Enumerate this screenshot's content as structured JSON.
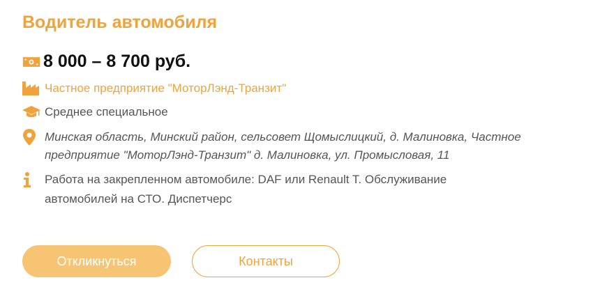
{
  "vacancy": {
    "title": "Водитель автомобиля",
    "salary": "8 000 – 8 700 руб.",
    "company": "Частное предприятие \"МоторЛэнд-Транзит\"",
    "education": "Среднее специальное",
    "address_line1": "Минская область, Минский район, сельсовет Щомыслицкий, д. Малиновка, Частное",
    "address_line2": "предприятие \"МоторЛэнд-Транзит\" д. Малиновка, ул. Промысловая, 11",
    "description_line1": "Работа на закрепленном автомобиле: DAF или Renault T. Обслуживание",
    "description_line2": "автомобилей на СТО. Диспетчерс"
  },
  "actions": {
    "respond_label": "Откликнуться",
    "contacts_label": "Контакты"
  },
  "icons": {
    "salary": "money-icon",
    "company": "factory-icon",
    "education": "graduation-cap-icon",
    "address": "location-pin-icon",
    "info": "info-icon"
  },
  "colors": {
    "accent": "#f0a33c",
    "accent_light": "#f6c473",
    "text": "#555555",
    "salary_text": "#111111"
  }
}
